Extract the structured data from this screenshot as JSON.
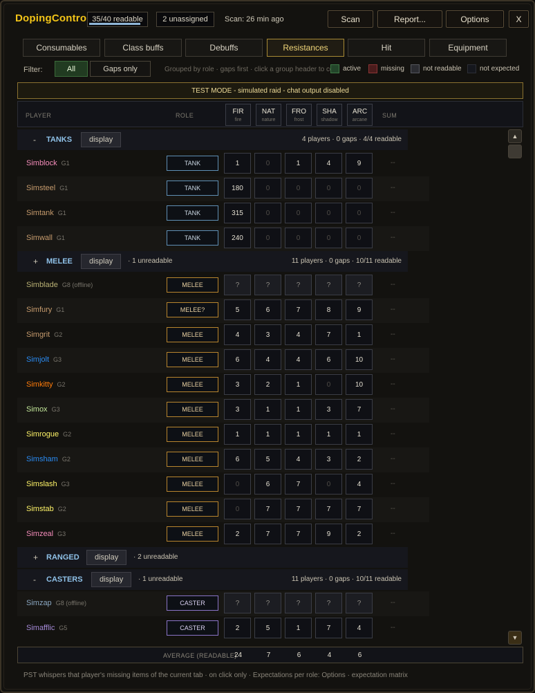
{
  "app": {
    "title": "DopingControl",
    "readable": "35/40 readable",
    "readable_fraction": 0.875,
    "unassigned": "2 unassigned",
    "scan_info": "Scan: 26 min ago",
    "btn_scan": "Scan",
    "btn_report": "Report...",
    "btn_options": "Options",
    "btn_close": "X"
  },
  "tabs": [
    "Consumables",
    "Class buffs",
    "Debuffs",
    "Resistances",
    "Hit",
    "Equipment"
  ],
  "active_tab": "Resistances",
  "filter": {
    "label": "Filter:",
    "all": "All",
    "gaps": "Gaps only",
    "hint": "Grouped by role · gaps first · click a group header to collapse"
  },
  "legend": [
    {
      "label": "active",
      "color": "#23452a",
      "border": "#3e7a45"
    },
    {
      "label": "missing",
      "color": "#4a1c1c",
      "border": "#8a3434"
    },
    {
      "label": "not readable",
      "color": "#2b2c31",
      "border": "#55575e"
    },
    {
      "label": "not expected",
      "color": "#15171d",
      "border": "#2c2e35"
    }
  ],
  "test_mode": "TEST MODE - simulated raid - chat output disabled",
  "columns": {
    "player": "PLAYER",
    "role": "ROLE",
    "sum": "SUM",
    "res": [
      {
        "abbr": "FIR",
        "name": "fire"
      },
      {
        "abbr": "NAT",
        "name": "nature"
      },
      {
        "abbr": "FRO",
        "name": "frost"
      },
      {
        "abbr": "SHA",
        "name": "shadow"
      },
      {
        "abbr": "ARC",
        "name": "arcane"
      }
    ]
  },
  "groups": [
    {
      "id": "tanks",
      "toggle": "-",
      "name": "TANKS",
      "display": "display",
      "unreadable": "",
      "summary": "4 players · 0 gaps · 4/4 readable",
      "players": [
        {
          "name": "Simblock",
          "group": "G1",
          "color": "#f48cba",
          "role": "TANK",
          "roleClass": "tank",
          "values": [
            "1",
            "0",
            "1",
            "4",
            "9"
          ],
          "sum": "--"
        },
        {
          "name": "Simsteel",
          "group": "G1",
          "color": "#c69b6d",
          "role": "TANK",
          "roleClass": "tank",
          "values": [
            "180",
            "0",
            "0",
            "0",
            "0"
          ],
          "sum": "--"
        },
        {
          "name": "Simtank",
          "group": "G1",
          "color": "#c69b6d",
          "role": "TANK",
          "roleClass": "tank",
          "values": [
            "315",
            "0",
            "0",
            "0",
            "0"
          ],
          "sum": "--"
        },
        {
          "name": "Simwall",
          "group": "G1",
          "color": "#c69b6d",
          "role": "TANK",
          "roleClass": "tank",
          "values": [
            "240",
            "0",
            "0",
            "0",
            "0"
          ],
          "sum": "--"
        }
      ]
    },
    {
      "id": "melee",
      "toggle": "+",
      "name": "MELEE",
      "display": "display",
      "unreadable": "· 1 unreadable",
      "summary": "11 players · 0 gaps · 10/11 readable",
      "players": [
        {
          "name": "Simblade",
          "group": "G8 (offline)",
          "color": "#b9b174",
          "role": "MELEE",
          "roleClass": "melee",
          "values": [
            "?",
            "?",
            "?",
            "?",
            "?"
          ],
          "sum": "--"
        },
        {
          "name": "Simfury",
          "group": "G1",
          "color": "#c69b6d",
          "role": "MELEE?",
          "roleClass": "melee",
          "values": [
            "5",
            "6",
            "7",
            "8",
            "9"
          ],
          "sum": "--"
        },
        {
          "name": "Simgrit",
          "group": "G2",
          "color": "#c69b6d",
          "role": "MELEE",
          "roleClass": "melee",
          "values": [
            "4",
            "3",
            "4",
            "7",
            "1"
          ],
          "sum": "--"
        },
        {
          "name": "Simjolt",
          "group": "G3",
          "color": "#2a8bf2",
          "role": "MELEE",
          "roleClass": "melee",
          "values": [
            "6",
            "4",
            "4",
            "6",
            "10"
          ],
          "sum": "--"
        },
        {
          "name": "Simkitty",
          "group": "G2",
          "color": "#ff7c0a",
          "role": "MELEE",
          "roleClass": "melee",
          "values": [
            "3",
            "2",
            "1",
            "0",
            "10"
          ],
          "sum": "--"
        },
        {
          "name": "Simox",
          "group": "G3",
          "color": "#c4e89a",
          "role": "MELEE",
          "roleClass": "melee",
          "values": [
            "3",
            "1",
            "1",
            "3",
            "7"
          ],
          "sum": "--"
        },
        {
          "name": "Simrogue",
          "group": "G2",
          "color": "#fff468",
          "role": "MELEE",
          "roleClass": "melee",
          "values": [
            "1",
            "1",
            "1",
            "1",
            "1"
          ],
          "sum": "--"
        },
        {
          "name": "Simsham",
          "group": "G2",
          "color": "#2a8bf2",
          "role": "MELEE",
          "roleClass": "melee",
          "values": [
            "6",
            "5",
            "4",
            "3",
            "2"
          ],
          "sum": "--"
        },
        {
          "name": "Simslash",
          "group": "G3",
          "color": "#fff468",
          "role": "MELEE",
          "roleClass": "melee",
          "values": [
            "0",
            "6",
            "7",
            "0",
            "4"
          ],
          "sum": "--"
        },
        {
          "name": "Simstab",
          "group": "G2",
          "color": "#fff468",
          "role": "MELEE",
          "roleClass": "melee",
          "values": [
            "0",
            "7",
            "7",
            "7",
            "7"
          ],
          "sum": "--"
        },
        {
          "name": "Simzeal",
          "group": "G3",
          "color": "#f48cba",
          "role": "MELEE",
          "roleClass": "melee",
          "values": [
            "2",
            "7",
            "7",
            "9",
            "2"
          ],
          "sum": "--"
        }
      ]
    },
    {
      "id": "ranged",
      "toggle": "+",
      "name": "RANGED",
      "display": "display",
      "unreadable": "· 2 unreadable",
      "summary": "",
      "players": []
    },
    {
      "id": "casters",
      "toggle": "-",
      "name": "CASTERS",
      "display": "display",
      "unreadable": "· 1 unreadable",
      "summary": "11 players · 0 gaps · 10/11 readable",
      "players": [
        {
          "name": "Simzap",
          "group": "G8 (offline)",
          "color": "#8aa6c0",
          "role": "CASTER",
          "roleClass": "caster",
          "values": [
            "?",
            "?",
            "?",
            "?",
            "?"
          ],
          "sum": "--"
        },
        {
          "name": "Simafflic",
          "group": "G5",
          "color": "#a58ad8",
          "role": "CASTER",
          "roleClass": "caster",
          "values": [
            "2",
            "5",
            "1",
            "7",
            "4"
          ],
          "sum": "--"
        }
      ]
    }
  ],
  "average": {
    "label": "AVERAGE (READABLE)",
    "values": [
      "24",
      "7",
      "6",
      "4",
      "6"
    ]
  },
  "footer": "PST whispers that player's missing items of the current tab · on click only · Expectations per role: Options · expectation matrix"
}
